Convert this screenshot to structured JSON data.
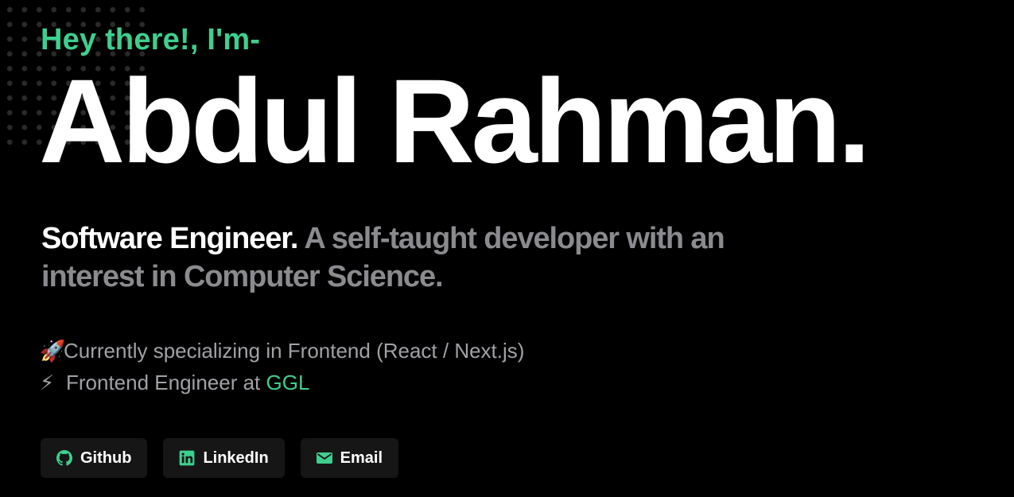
{
  "colors": {
    "background": "#000000",
    "accent": "#3ecf8e",
    "heading": "#ffffff",
    "muted": "#8a8a8f",
    "button_bg": "#161616"
  },
  "hero": {
    "greeting": "Hey there!, I'm-",
    "name": "Abdul Rahman.",
    "role": "Software Engineer.",
    "description": " A self-taught developer with an interest in Computer Science."
  },
  "bullets": {
    "item1": {
      "icon": "rocket-icon",
      "emoji": "🚀",
      "text": "Currently specializing in Frontend (React / Next.js)"
    },
    "item2": {
      "icon": "lightning-icon",
      "emoji": "⚡",
      "text": "Frontend Engineer at ",
      "company": "GGL"
    }
  },
  "buttons": {
    "github": {
      "label": "Github",
      "icon": "github-icon"
    },
    "linkedin": {
      "label": "LinkedIn",
      "icon": "linkedin-icon"
    },
    "email": {
      "label": "Email",
      "icon": "mail-icon"
    }
  }
}
